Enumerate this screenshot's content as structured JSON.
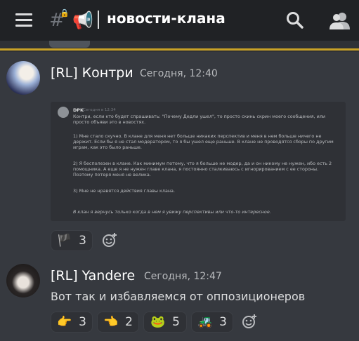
{
  "header": {
    "channel_name": "новости-клана",
    "channel_icon": "hash-lock-icon",
    "announce_icon": "megaphone-icon"
  },
  "messages": [
    {
      "username": "[RL] Контри",
      "timestamp": "Сегодня, 12:40",
      "embed": {
        "author": "DPK",
        "time": "Сегодня в 12:34",
        "lines": [
          "Контри, если кто будет спрашивать: \"Почему Дедли ушел\", то просто скинь скрин моего сообщения, или просто объяви это в новостях.",
          "1) Мне стало скучно. В клане для меня нет больше никаких перспектив и меня в нем больше ничего не держит. Если бы я не стал модератором, то я бы ушел еще раньше. В клане не проводятся сборы по другим играм, как это было раньше.",
          "2) Я бесполезен в клане. Как минимум потому, что я больше не модер, да и он никому не нужен, ибо есть 2 помощника. А еще я не нужен главе клана, я постоянно сталкиваюсь с игнорированием с ее стороны. Поэтому потеря меня не велика.",
          "3) Мне не нравятся действия главы клана.",
          "В клан я вернусь только когда в нем я увижу перспективы или что-то интересное."
        ]
      },
      "reactions": [
        {
          "emoji": "flag-icon",
          "glyph": "🏴",
          "count": "3"
        }
      ]
    },
    {
      "username": "[RL] Yandere",
      "timestamp": "Сегодня, 12:47",
      "text": "Вот так и избавляемся от оппозиционеров",
      "reactions": [
        {
          "emoji": "point-right-icon",
          "glyph": "👉",
          "count": "3"
        },
        {
          "emoji": "point-left-icon",
          "glyph": "👈",
          "count": "2"
        },
        {
          "emoji": "pepe-icon",
          "glyph": "🐸",
          "count": "5"
        },
        {
          "emoji": "tank-icon",
          "glyph": "🚜",
          "count": "3"
        }
      ]
    }
  ],
  "colors": {
    "background": "#36393f",
    "topbar": "#202225",
    "accent_gold": "#c9a227"
  }
}
